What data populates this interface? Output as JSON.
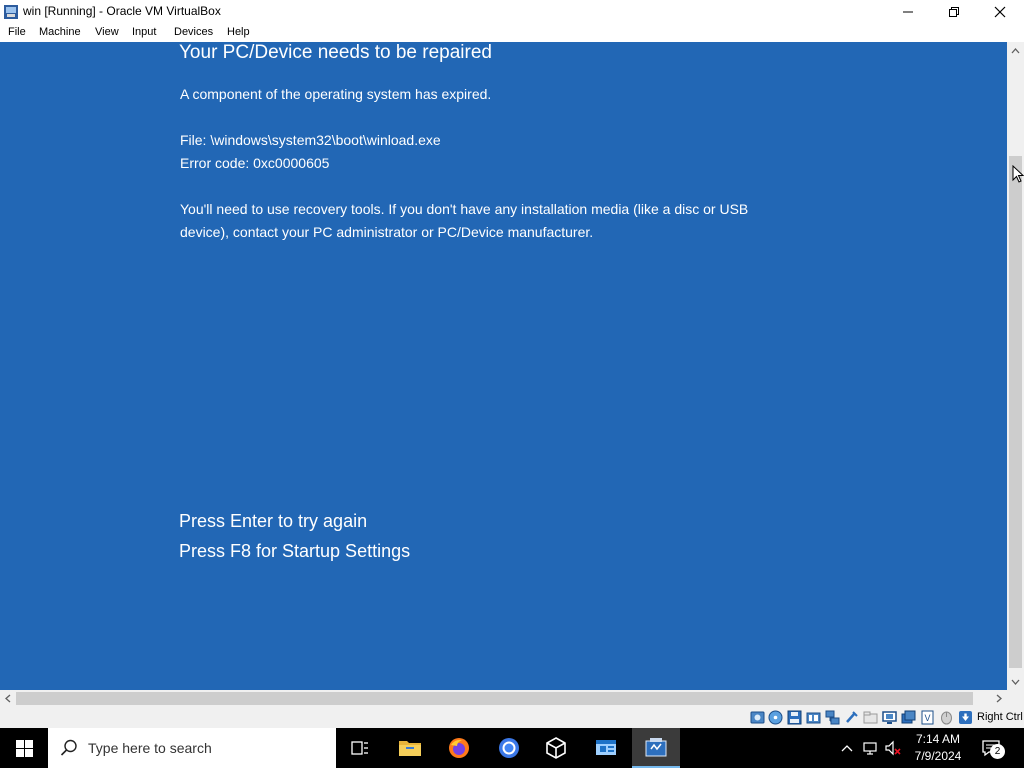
{
  "window": {
    "title": "win [Running] - Oracle VM VirtualBox"
  },
  "menu": {
    "items": [
      "File",
      "Machine",
      "View",
      "Input",
      "Devices",
      "Help"
    ]
  },
  "bsod": {
    "title": "Your PC/Device needs to be repaired",
    "message": "A component of the operating system has expired.",
    "file_line": "File: \\windows\\system32\\boot\\winload.exe",
    "error_line": "Error code: 0xc0000605",
    "recovery_line1": "You'll need to use recovery tools. If you don't have any installation media (like a disc or USB",
    "recovery_line2": "device), contact your PC administrator or PC/Device manufacturer.",
    "action_enter": "Press Enter to try again",
    "action_f8": "Press F8 for Startup Settings"
  },
  "vbox_status": {
    "host_key": "Right Ctrl",
    "icons": [
      "hard-disk-icon",
      "optical-drive-icon",
      "floppy-icon",
      "audio-icon",
      "network-icon",
      "usb-icon",
      "shared-folders-icon",
      "display-icon",
      "video-capture-icon",
      "cpu-icon",
      "mouse-integration-icon",
      "host-key-icon"
    ]
  },
  "taskbar": {
    "search_placeholder": "Type here to search",
    "apps": [
      "task-view-icon",
      "file-explorer-icon",
      "firefox-icon",
      "chrome-icon",
      "virtualbox-3d-icon",
      "outlook-app-icon",
      "virtualbox-vm-icon"
    ],
    "clock_time": "7:14 AM",
    "clock_date": "7/9/2024",
    "notification_count": "2"
  },
  "colors": {
    "bsod_background": "#2267b5",
    "taskbar_background": "#000000",
    "active_app_underline": "#76b9ed"
  }
}
